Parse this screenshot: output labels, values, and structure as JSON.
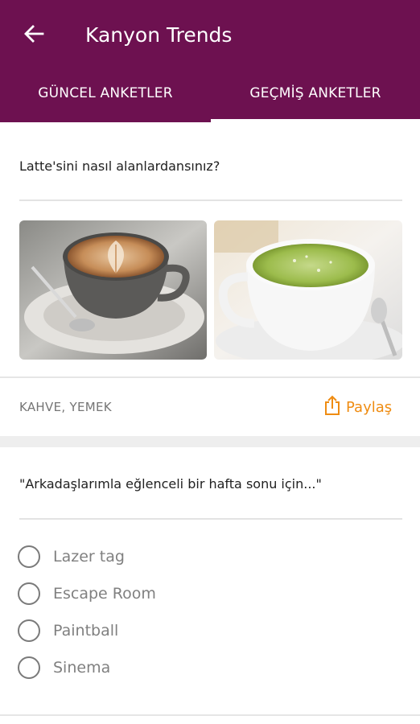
{
  "app_bar": {
    "title": "Kanyon Trends",
    "back_icon": "arrow-left-icon",
    "background_color": "#6d1150"
  },
  "tabs": [
    {
      "label": "GÜNCEL ANKETLER",
      "selected": false
    },
    {
      "label": "GEÇMİŞ ANKETLER",
      "selected": true
    }
  ],
  "poll_1": {
    "question": "Latte'sini nasıl alanlardansınız?",
    "images": [
      "latte-art-cup",
      "matcha-latte-cup"
    ],
    "tags": "KAHVE, YEMEK",
    "share_label": "Paylaş",
    "share_icon": "share-icon",
    "share_color": "#ef8c12"
  },
  "poll_2": {
    "question": "\"Arkadaşlarımla eğlenceli bir hafta sonu için...\"",
    "options": [
      "Lazer tag",
      "Escape Room",
      "Paintball",
      "Sinema"
    ]
  }
}
